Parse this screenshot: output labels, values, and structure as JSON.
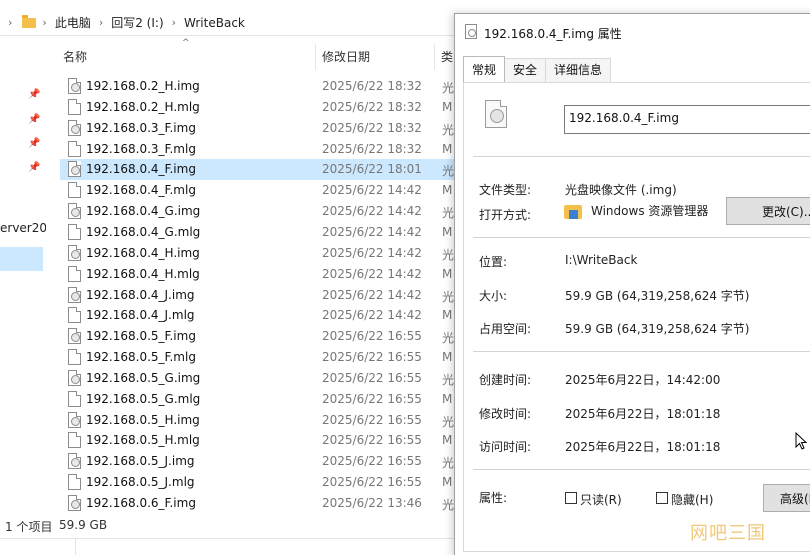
{
  "explorer": {
    "breadcrumb": [
      "此电脑",
      "回写2 (I:)",
      "WriteBack"
    ],
    "nav_label": "erver20",
    "columns": {
      "name": "名称",
      "date": "修改日期",
      "type": "类"
    },
    "files": [
      {
        "name": "192.168.0.2_H.img",
        "date": "2025/6/22 18:32",
        "type": "光",
        "icon": "disc-image"
      },
      {
        "name": "192.168.0.2_H.mlg",
        "date": "2025/6/22 18:32",
        "type": "M",
        "icon": "blank-file"
      },
      {
        "name": "192.168.0.3_F.img",
        "date": "2025/6/22 18:32",
        "type": "光",
        "icon": "disc-image"
      },
      {
        "name": "192.168.0.3_F.mlg",
        "date": "2025/6/22 18:32",
        "type": "M",
        "icon": "blank-file"
      },
      {
        "name": "192.168.0.4_F.img",
        "date": "2025/6/22 18:01",
        "type": "光",
        "icon": "disc-image",
        "selected": true
      },
      {
        "name": "192.168.0.4_F.mlg",
        "date": "2025/6/22 14:42",
        "type": "M",
        "icon": "blank-file"
      },
      {
        "name": "192.168.0.4_G.img",
        "date": "2025/6/22 14:42",
        "type": "光",
        "icon": "disc-image"
      },
      {
        "name": "192.168.0.4_G.mlg",
        "date": "2025/6/22 14:42",
        "type": "M",
        "icon": "blank-file"
      },
      {
        "name": "192.168.0.4_H.img",
        "date": "2025/6/22 14:42",
        "type": "光",
        "icon": "disc-image"
      },
      {
        "name": "192.168.0.4_H.mlg",
        "date": "2025/6/22 14:42",
        "type": "M",
        "icon": "blank-file"
      },
      {
        "name": "192.168.0.4_J.img",
        "date": "2025/6/22 14:42",
        "type": "光",
        "icon": "disc-image"
      },
      {
        "name": "192.168.0.4_J.mlg",
        "date": "2025/6/22 14:42",
        "type": "M",
        "icon": "blank-file"
      },
      {
        "name": "192.168.0.5_F.img",
        "date": "2025/6/22 16:55",
        "type": "光",
        "icon": "disc-image"
      },
      {
        "name": "192.168.0.5_F.mlg",
        "date": "2025/6/22 16:55",
        "type": "M",
        "icon": "blank-file"
      },
      {
        "name": "192.168.0.5_G.img",
        "date": "2025/6/22 16:55",
        "type": "光",
        "icon": "disc-image"
      },
      {
        "name": "192.168.0.5_G.mlg",
        "date": "2025/6/22 16:55",
        "type": "M",
        "icon": "blank-file"
      },
      {
        "name": "192.168.0.5_H.img",
        "date": "2025/6/22 16:55",
        "type": "光",
        "icon": "disc-image"
      },
      {
        "name": "192.168.0.5_H.mlg",
        "date": "2025/6/22 16:55",
        "type": "M",
        "icon": "blank-file"
      },
      {
        "name": "192.168.0.5_J.img",
        "date": "2025/6/22 16:55",
        "type": "光",
        "icon": "disc-image"
      },
      {
        "name": "192.168.0.5_J.mlg",
        "date": "2025/6/22 16:55",
        "type": "M",
        "icon": "blank-file"
      },
      {
        "name": "192.168.0.6_F.img",
        "date": "2025/6/22 13:46",
        "type": "光",
        "icon": "disc-image"
      }
    ],
    "status": {
      "selected": "1 个项目",
      "size": "59.9 GB"
    },
    "selection_color": "#cce8ff"
  },
  "properties": {
    "title": "192.168.0.4_F.img 属性",
    "tabs": [
      "常规",
      "安全",
      "详细信息"
    ],
    "active_tab": "常规",
    "filename": "192.168.0.4_F.img",
    "file_type_label": "文件类型:",
    "file_type": "光盘映像文件 (.img)",
    "open_with_label": "打开方式:",
    "open_with_app": "Windows 资源管理器",
    "change_button": "更改(C)...",
    "location_label": "位置:",
    "location": "I:\\WriteBack",
    "size_label": "大小:",
    "size": "59.9 GB (64,319,258,624 字节)",
    "disk_size_label": "占用空间:",
    "disk_size": "59.9 GB (64,319,258,624 字节)",
    "created_label": "创建时间:",
    "created": "2025年6月22日，14:42:00",
    "modified_label": "修改时间:",
    "modified": "2025年6月22日，18:01:18",
    "accessed_label": "访问时间:",
    "accessed": "2025年6月22日，18:01:18",
    "attributes_label": "属性:",
    "readonly_label": "只读(R)",
    "readonly_checked": false,
    "hidden_label": "隐藏(H)",
    "hidden_checked": false,
    "advanced_button": "高级(D)..."
  },
  "watermark": "网吧三国",
  "colors": {
    "watermark": "#f0c36a",
    "folder": "#f3c14b",
    "button": "#e1e1e1"
  }
}
